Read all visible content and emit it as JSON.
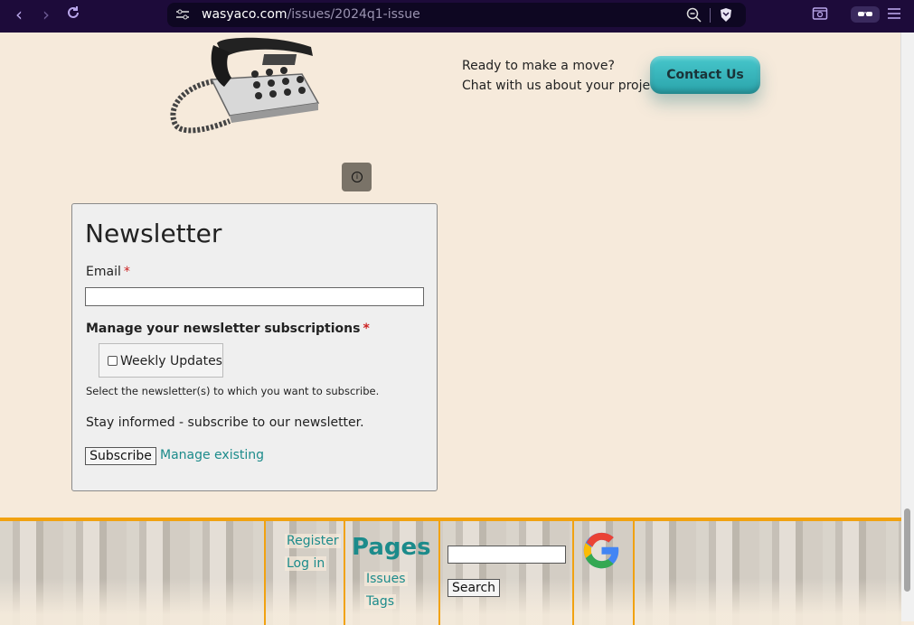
{
  "browser": {
    "url_host": "wasyaco.com",
    "url_path": "/issues/2024q1-issue",
    "icons": [
      "back-icon",
      "forward-icon",
      "reload-icon",
      "site-settings-icon",
      "zoom-icon",
      "brave-shield-icon",
      "tab-search-icon",
      "reader-mode-icon",
      "menu-icon"
    ]
  },
  "hero": {
    "cta_line1": "Ready to make a move?",
    "cta_line2": "Chat with us about your project:",
    "contact_label": "Contact Us"
  },
  "newsletter": {
    "title": "Newsletter",
    "email_label": "Email",
    "required_mark": "*",
    "subscriptions_label": "Manage your newsletter subscriptions",
    "option_label": "Weekly Updates",
    "help_text": "Select the newsletter(s) to which you want to subscribe.",
    "stay_text": "Stay informed - subscribe to our newsletter.",
    "subscribe_label": "Subscribe",
    "manage_label": "Manage existing"
  },
  "footer": {
    "register_label": "Register",
    "login_label": "Log in",
    "pages_title": "Pages",
    "issues_label": "Issues",
    "tags_label": "Tags",
    "search_label": "Search"
  },
  "colors": {
    "link": "#1c8b8b",
    "accent": "#f1a211",
    "topbar": "#1d0b3a"
  }
}
